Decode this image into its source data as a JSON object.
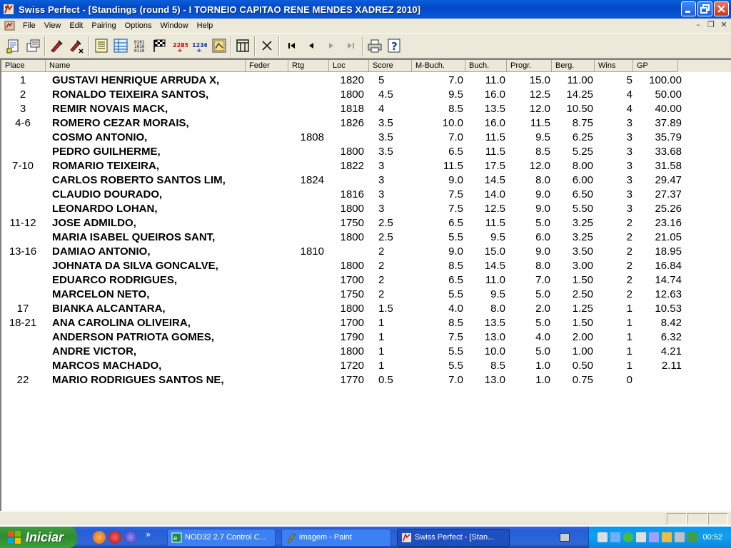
{
  "window": {
    "title": "Swiss Perfect - [Standings  (round 5) - I TORNEIO CAPITAO RENE MENDES XADREZ 2010]"
  },
  "menu": [
    "File",
    "View",
    "Edit",
    "Pairing",
    "Options",
    "Window",
    "Help"
  ],
  "toolbar": {
    "icons": [
      "new-tournament-icon",
      "open-tournament-icon",
      "edit-players-icon",
      "withdraw-player-icon",
      "standings-icon",
      "crosstable-icon",
      "pairing-icon",
      "checkered-flag-icon",
      "rating-2285-icon",
      "rating-1236-icon",
      "export-icon",
      "scoreboard-icon",
      "cross-icon",
      "first-record-icon",
      "previous-record-icon",
      "next-record-icon",
      "last-record-icon",
      "print-icon",
      "help-icon"
    ],
    "rating_icon_a": "2285",
    "rating_icon_b": "1236"
  },
  "table": {
    "columns": [
      "Place",
      "Name",
      "Feder",
      "Rtg",
      "Loc",
      "Score",
      "M-Buch.",
      "Buch.",
      "Progr.",
      "Berg.",
      "Wins",
      "GP"
    ],
    "rows": [
      {
        "place": "1",
        "name": "GUSTAVI HENRIQUE ARRUDA X,",
        "rtg": "",
        "loc": "1820",
        "score": "5",
        "mbuch": "7.0",
        "buch": "11.0",
        "progr": "15.0",
        "berg": "11.00",
        "wins": "5",
        "gp": "100.00"
      },
      {
        "place": "2",
        "name": "RONALDO TEIXEIRA SANTOS,",
        "rtg": "",
        "loc": "1800",
        "score": "4.5",
        "mbuch": "9.5",
        "buch": "16.0",
        "progr": "12.5",
        "berg": "14.25",
        "wins": "4",
        "gp": "50.00"
      },
      {
        "place": "3",
        "name": "REMIR NOVAIS MACK,",
        "rtg": "",
        "loc": "1818",
        "score": "4",
        "mbuch": "8.5",
        "buch": "13.5",
        "progr": "12.0",
        "berg": "10.50",
        "wins": "4",
        "gp": "40.00"
      },
      {
        "place": "4-6",
        "name": "ROMERO CEZAR MORAIS,",
        "rtg": "",
        "loc": "1826",
        "score": "3.5",
        "mbuch": "10.0",
        "buch": "16.0",
        "progr": "11.5",
        "berg": "8.75",
        "wins": "3",
        "gp": "37.89"
      },
      {
        "place": "",
        "name": "COSMO ANTONIO,",
        "rtg": "1808",
        "loc": "",
        "score": "3.5",
        "mbuch": "7.0",
        "buch": "11.5",
        "progr": "9.5",
        "berg": "6.25",
        "wins": "3",
        "gp": "35.79"
      },
      {
        "place": "",
        "name": "PEDRO GUILHERME,",
        "rtg": "",
        "loc": "1800",
        "score": "3.5",
        "mbuch": "6.5",
        "buch": "11.5",
        "progr": "8.5",
        "berg": "5.25",
        "wins": "3",
        "gp": "33.68"
      },
      {
        "place": "7-10",
        "name": "ROMARIO TEIXEIRA,",
        "rtg": "",
        "loc": "1822",
        "score": "3",
        "mbuch": "11.5",
        "buch": "17.5",
        "progr": "12.0",
        "berg": "8.00",
        "wins": "3",
        "gp": "31.58"
      },
      {
        "place": "",
        "name": "CARLOS ROBERTO SANTOS LIM,",
        "rtg": "1824",
        "loc": "",
        "score": "3",
        "mbuch": "9.0",
        "buch": "14.5",
        "progr": "8.0",
        "berg": "6.00",
        "wins": "3",
        "gp": "29.47"
      },
      {
        "place": "",
        "name": "CLAUDIO DOURADO,",
        "rtg": "",
        "loc": "1816",
        "score": "3",
        "mbuch": "7.5",
        "buch": "14.0",
        "progr": "9.0",
        "berg": "6.50",
        "wins": "3",
        "gp": "27.37"
      },
      {
        "place": "",
        "name": "LEONARDO LOHAN,",
        "rtg": "",
        "loc": "1800",
        "score": "3",
        "mbuch": "7.5",
        "buch": "12.5",
        "progr": "9.0",
        "berg": "5.50",
        "wins": "3",
        "gp": "25.26"
      },
      {
        "place": "11-12",
        "name": "JOSE ADMILDO,",
        "rtg": "",
        "loc": "1750",
        "score": "2.5",
        "mbuch": "6.5",
        "buch": "11.5",
        "progr": "5.0",
        "berg": "3.25",
        "wins": "2",
        "gp": "23.16"
      },
      {
        "place": "",
        "name": "MARIA ISABEL QUEIROS SANT,",
        "rtg": "",
        "loc": "1800",
        "score": "2.5",
        "mbuch": "5.5",
        "buch": "9.5",
        "progr": "6.0",
        "berg": "3.25",
        "wins": "2",
        "gp": "21.05"
      },
      {
        "place": "13-16",
        "name": "DAMIAO ANTONIO,",
        "rtg": "1810",
        "loc": "",
        "score": "2",
        "mbuch": "9.0",
        "buch": "15.0",
        "progr": "9.0",
        "berg": "3.50",
        "wins": "2",
        "gp": "18.95"
      },
      {
        "place": "",
        "name": "JOHNATA DA SILVA GONCALVE,",
        "rtg": "",
        "loc": "1800",
        "score": "2",
        "mbuch": "8.5",
        "buch": "14.5",
        "progr": "8.0",
        "berg": "3.00",
        "wins": "2",
        "gp": "16.84"
      },
      {
        "place": "",
        "name": "EDUARCO RODRIGUES,",
        "rtg": "",
        "loc": "1700",
        "score": "2",
        "mbuch": "6.5",
        "buch": "11.0",
        "progr": "7.0",
        "berg": "1.50",
        "wins": "2",
        "gp": "14.74"
      },
      {
        "place": "",
        "name": "MARCELON NETO,",
        "rtg": "",
        "loc": "1750",
        "score": "2",
        "mbuch": "5.5",
        "buch": "9.5",
        "progr": "5.0",
        "berg": "2.50",
        "wins": "2",
        "gp": "12.63"
      },
      {
        "place": "17",
        "name": "BIANKA ALCANTARA,",
        "rtg": "",
        "loc": "1800",
        "score": "1.5",
        "mbuch": "4.0",
        "buch": "8.0",
        "progr": "2.0",
        "berg": "1.25",
        "wins": "1",
        "gp": "10.53"
      },
      {
        "place": "18-21",
        "name": "ANA CAROLINA OLIVEIRA,",
        "rtg": "",
        "loc": "1700",
        "score": "1",
        "mbuch": "8.5",
        "buch": "13.5",
        "progr": "5.0",
        "berg": "1.50",
        "wins": "1",
        "gp": "8.42"
      },
      {
        "place": "",
        "name": "ANDERSON PATRIOTA GOMES,",
        "rtg": "",
        "loc": "1790",
        "score": "1",
        "mbuch": "7.5",
        "buch": "13.0",
        "progr": "4.0",
        "berg": "2.00",
        "wins": "1",
        "gp": "6.32"
      },
      {
        "place": "",
        "name": "ANDRE VICTOR,",
        "rtg": "",
        "loc": "1800",
        "score": "1",
        "mbuch": "5.5",
        "buch": "10.0",
        "progr": "5.0",
        "berg": "1.00",
        "wins": "1",
        "gp": "4.21"
      },
      {
        "place": "",
        "name": "MARCOS MACHADO,",
        "rtg": "",
        "loc": "1720",
        "score": "1",
        "mbuch": "5.5",
        "buch": "8.5",
        "progr": "1.0",
        "berg": "0.50",
        "wins": "1",
        "gp": "2.11"
      },
      {
        "place": "22",
        "name": "MARIO RODRIGUES SANTOS NE,",
        "rtg": "",
        "loc": "1770",
        "score": "0.5",
        "mbuch": "7.0",
        "buch": "13.0",
        "progr": "1.0",
        "berg": "0.75",
        "wins": "0",
        "gp": ""
      }
    ]
  },
  "taskbar": {
    "start_label": "Iniciar",
    "tasks": [
      {
        "label": "NOD32 2.7 Control C...",
        "active": false
      },
      {
        "label": "imagem - Paint",
        "active": false
      },
      {
        "label": "Swiss Perfect - [Stan...",
        "active": true
      }
    ],
    "clock": "00:52"
  },
  "colors": {
    "titlebar": "#0349c9",
    "taskbar": "#245edb",
    "start_button": "#2f8c2f",
    "tray": "#109fef",
    "chrome": "#ece9d8"
  }
}
